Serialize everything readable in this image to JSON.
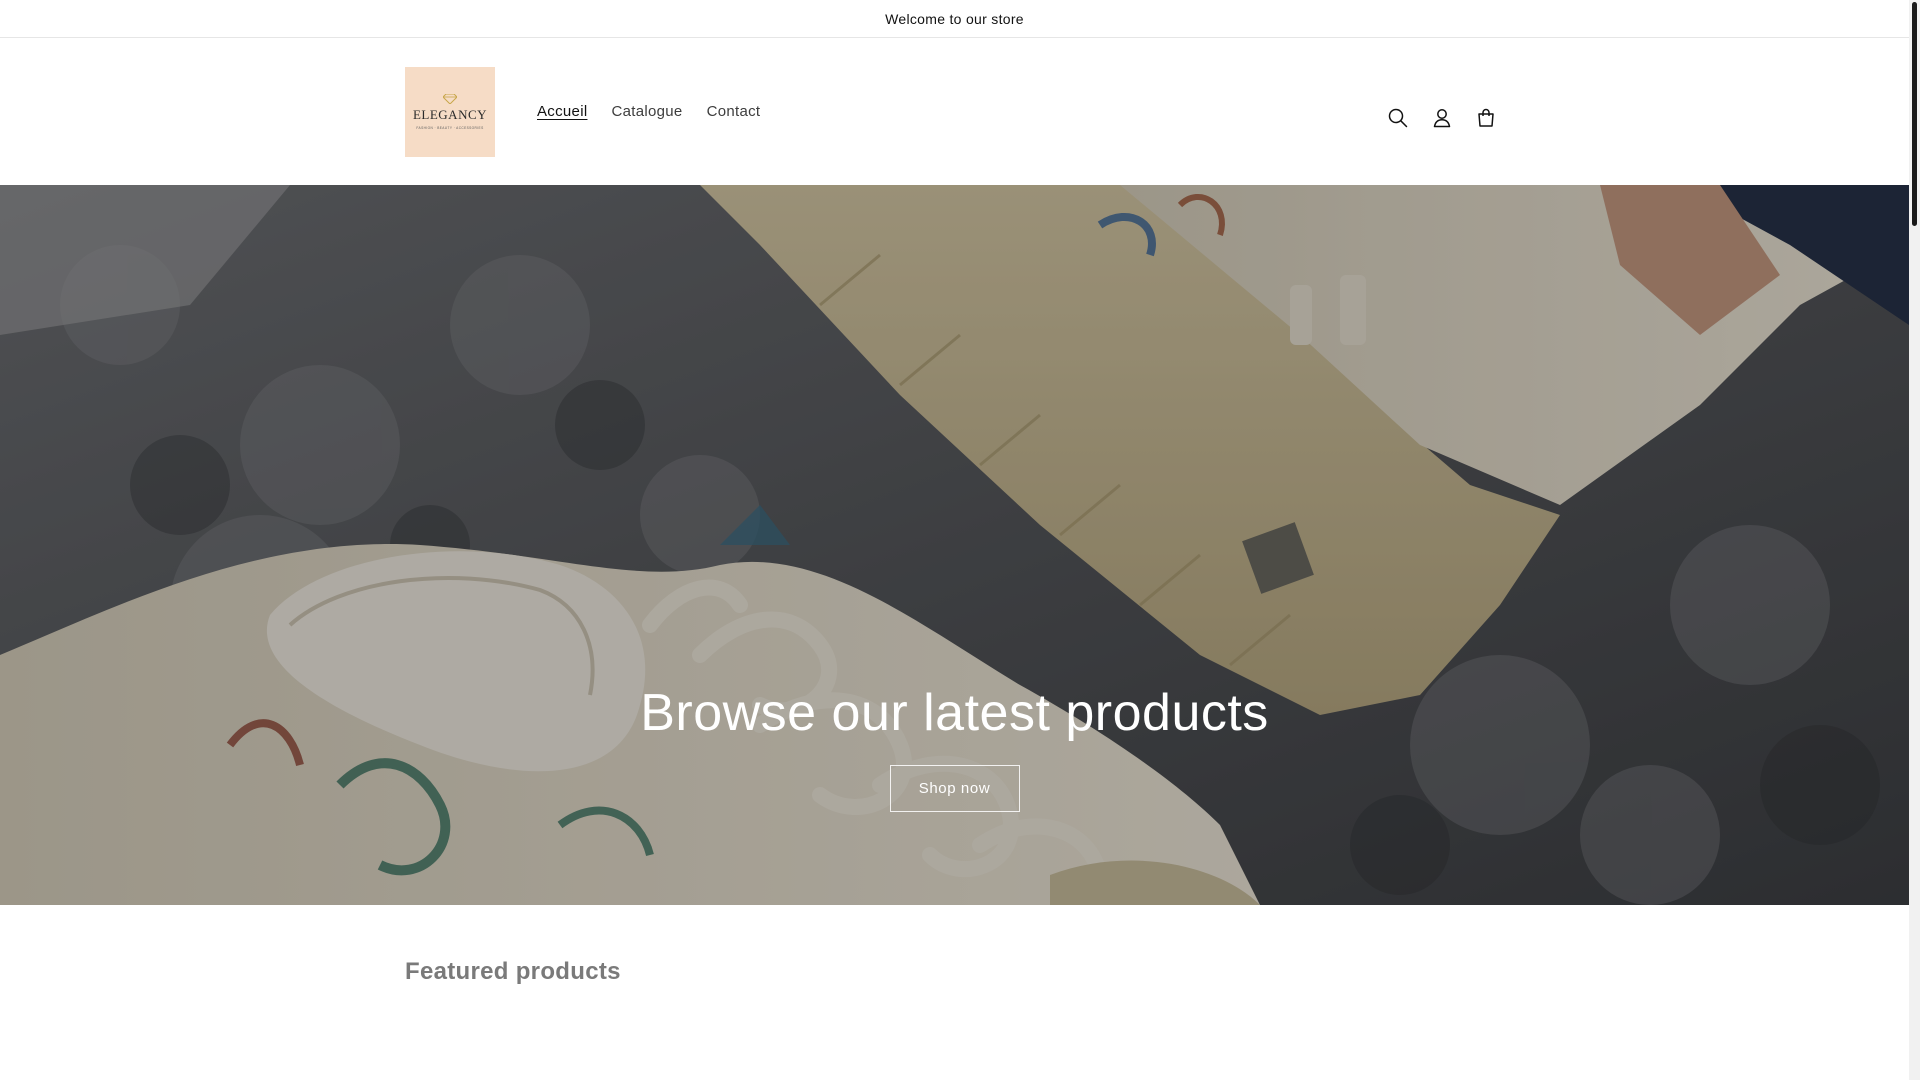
{
  "announcement": {
    "text": "Welcome to our store"
  },
  "header": {
    "logo": {
      "brand": "ELEGANCY",
      "tagline": "FASHION · BEAUTY · ACCESSORIES"
    },
    "nav": [
      {
        "label": "Accueil",
        "active": true
      },
      {
        "label": "Catalogue",
        "active": false
      },
      {
        "label": "Contact",
        "active": false
      }
    ],
    "icons": [
      "search-icon",
      "account-icon",
      "cart-icon"
    ]
  },
  "hero": {
    "heading": "Browse our latest products",
    "button_label": "Shop now"
  },
  "featured": {
    "heading": "Featured products"
  },
  "colors": {
    "logo_bg": "#f6dcc6",
    "text": "#121212",
    "muted": "#7a7a7a"
  }
}
